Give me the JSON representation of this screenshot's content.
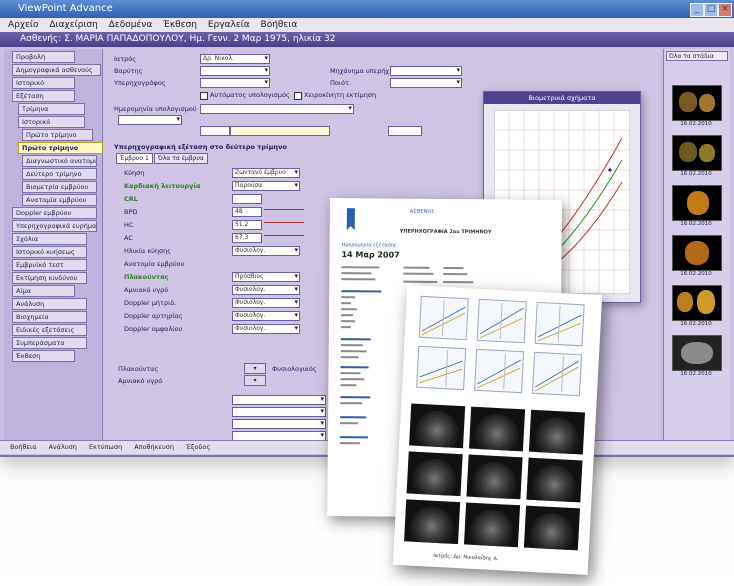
{
  "app": {
    "title": "ViewPoint Advance",
    "menu": [
      "Αρχείο",
      "Διαχείριση",
      "Δεδομένα",
      "Έκθεση",
      "Εργαλεία",
      "Βοήθεια"
    ],
    "document_title": "Ασθενής: Σ. ΜΑΡΙΑ ΠΑΠΑΔΟΠΟΥΛΟΥ, Ημ. Γενν. 2 Μαρ 1975, ηλικία 32"
  },
  "sidebar": {
    "items": [
      "Προβολή",
      "Δημογραφικά ασθενούς",
      "Ιστορικό",
      "Εξέταση",
      "Τρίμηνα",
      "Ιστορικό",
      "Πρώτο τρίμηνο",
      "Πρώτο τρίμηνο",
      "Διαγνωστικό ανατομικό",
      "Δεύτερο τρίμηνο",
      "Βιομετρία εμβρύου",
      "Ανατομία εμβρύου",
      "Doppler εμβρύου",
      "Υπερηχογραφικά ευρήματα",
      "Σχόλια",
      "Ιστορικό κυήσεως",
      "Εμβρυϊκό τεστ",
      "Εκτίμηση κινδύνου",
      "Αίμα",
      "Ανάλυση",
      "Βιοχημεία",
      "Ειδικές εξετάσεις",
      "Συμπεράσματα",
      "Έκθεση"
    ],
    "active_index": 7
  },
  "form": {
    "top_fields": [
      {
        "label": "Ιατρός",
        "value": "Δρ. Νικολ."
      },
      {
        "label": "Βαρύτης",
        "value": ""
      },
      {
        "label": "Υπερηχογράφος",
        "value": ""
      }
    ],
    "right_fields": [
      {
        "label": "Μηχάνημα υπερήχ.",
        "value": ""
      },
      {
        "label": "Ποιότ.",
        "value": ""
      }
    ],
    "checkboxes": [
      "Αυτόματος υπολογισμός",
      "Χειροκίνητη εκτίμηση"
    ],
    "dating_label": "Ημερομηνία υπολογισμού",
    "section_title": "Υπερηχογραφική εξέταση στο δεύτερο τρίμηνο",
    "tabs": [
      "Έμβρυο 1",
      "Όλα τα έμβρυα"
    ],
    "rows": [
      {
        "label": "Κύηση",
        "value": "Ζωντανό έμβρυο",
        "green": false
      },
      {
        "label": "Καρδιακή λειτουργία",
        "value": "Παρούσα",
        "green": true
      },
      {
        "label": "CRL",
        "value": "",
        "green": true
      },
      {
        "label": "BPD",
        "value": "48",
        "green": false
      },
      {
        "label": "HC",
        "value": "51.2",
        "green": false
      },
      {
        "label": "AC",
        "value": "67.3",
        "green": false
      },
      {
        "label": "Ηλικία κύησης",
        "value": "Φυσιολογ.",
        "green": false
      },
      {
        "label": "Ανατομία εμβρύου",
        "value": "",
        "green": false
      },
      {
        "label": "Πλακούντας",
        "value": "Πρόσθιος",
        "green": true
      },
      {
        "label": "Αμνιακό υγρό",
        "value": "Φυσιολογ.",
        "green": false
      },
      {
        "label": "Doppler μήτριδ.",
        "value": "Φυσιολογ.",
        "green": false
      },
      {
        "label": "Doppler αρτηρίας",
        "value": "Φυσιολογ.",
        "green": false
      },
      {
        "label": "Doppler ομφαλίου",
        "value": "Φυσιολογ.",
        "green": false
      }
    ],
    "plaque_label": "Πλακούντας",
    "plaque_value": "Φυσιολογικός",
    "amniotic_label": "Αμνιακό υγρό"
  },
  "chart_window": {
    "title": "Βιομετρικά σχήματα"
  },
  "thumbnails": {
    "header": "Όλα τα στάδια",
    "captions": [
      "16.02.2010",
      "16.02.2010",
      "16.02.2010",
      "16.02.2010",
      "16.02.2010",
      "16.02.2010"
    ]
  },
  "status": [
    "Βοήθεια",
    "Ανάλυση",
    "Εκτύπωση",
    "Αποθήκευση",
    "Έξοδος"
  ],
  "report1": {
    "header": "ΑΣΘΕΝΗΣ",
    "title": "ΥΠΕΡΗΧΟΓΡΑΦΙΑ 2ου ΤΡΙΜΗΝΟΥ",
    "date_label": "Ημερομηνία εξέτασης",
    "date": "14 Μαρ 2007"
  },
  "report2": {
    "footer": "Ιατρός: Δρ. Νικολαΐδης Α."
  }
}
